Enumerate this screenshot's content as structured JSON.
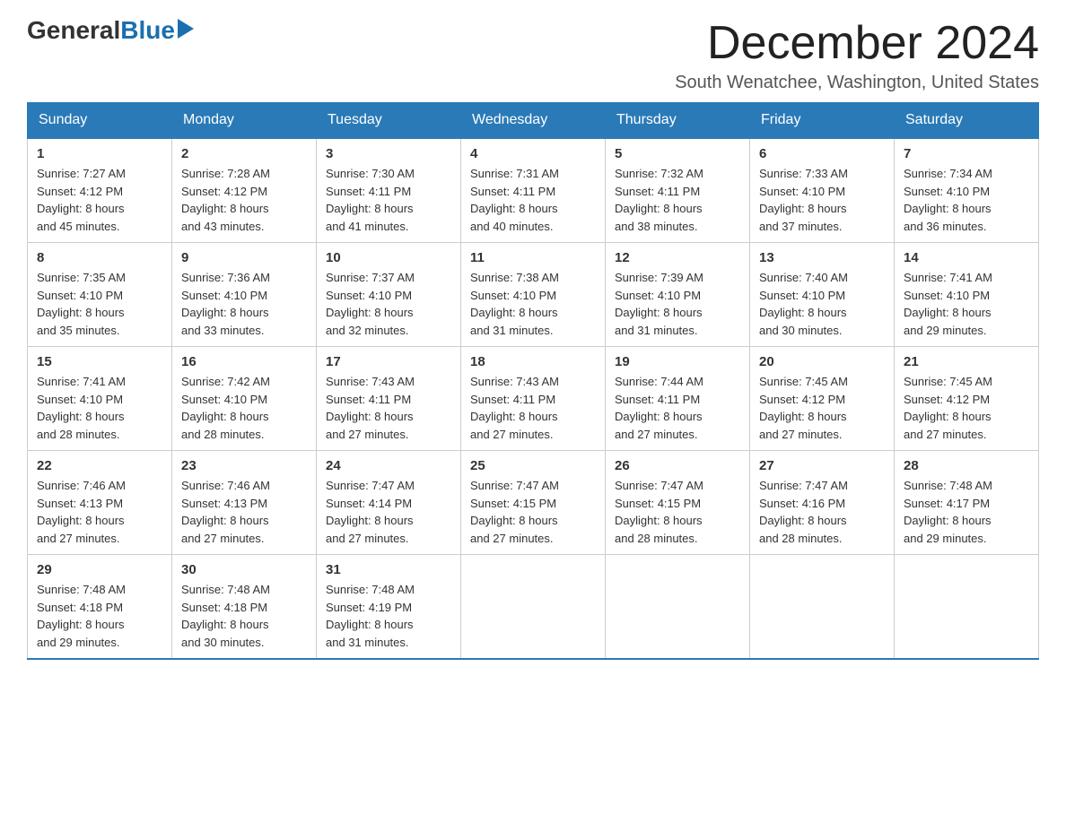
{
  "logo": {
    "general": "General",
    "blue": "Blue",
    "arrow": "▶"
  },
  "title": "December 2024",
  "location": "South Wenatchee, Washington, United States",
  "days_of_week": [
    "Sunday",
    "Monday",
    "Tuesday",
    "Wednesday",
    "Thursday",
    "Friday",
    "Saturday"
  ],
  "weeks": [
    [
      {
        "day": "1",
        "sunrise": "7:27 AM",
        "sunset": "4:12 PM",
        "daylight": "8 hours and 45 minutes."
      },
      {
        "day": "2",
        "sunrise": "7:28 AM",
        "sunset": "4:12 PM",
        "daylight": "8 hours and 43 minutes."
      },
      {
        "day": "3",
        "sunrise": "7:30 AM",
        "sunset": "4:11 PM",
        "daylight": "8 hours and 41 minutes."
      },
      {
        "day": "4",
        "sunrise": "7:31 AM",
        "sunset": "4:11 PM",
        "daylight": "8 hours and 40 minutes."
      },
      {
        "day": "5",
        "sunrise": "7:32 AM",
        "sunset": "4:11 PM",
        "daylight": "8 hours and 38 minutes."
      },
      {
        "day": "6",
        "sunrise": "7:33 AM",
        "sunset": "4:10 PM",
        "daylight": "8 hours and 37 minutes."
      },
      {
        "day": "7",
        "sunrise": "7:34 AM",
        "sunset": "4:10 PM",
        "daylight": "8 hours and 36 minutes."
      }
    ],
    [
      {
        "day": "8",
        "sunrise": "7:35 AM",
        "sunset": "4:10 PM",
        "daylight": "8 hours and 35 minutes."
      },
      {
        "day": "9",
        "sunrise": "7:36 AM",
        "sunset": "4:10 PM",
        "daylight": "8 hours and 33 minutes."
      },
      {
        "day": "10",
        "sunrise": "7:37 AM",
        "sunset": "4:10 PM",
        "daylight": "8 hours and 32 minutes."
      },
      {
        "day": "11",
        "sunrise": "7:38 AM",
        "sunset": "4:10 PM",
        "daylight": "8 hours and 31 minutes."
      },
      {
        "day": "12",
        "sunrise": "7:39 AM",
        "sunset": "4:10 PM",
        "daylight": "8 hours and 31 minutes."
      },
      {
        "day": "13",
        "sunrise": "7:40 AM",
        "sunset": "4:10 PM",
        "daylight": "8 hours and 30 minutes."
      },
      {
        "day": "14",
        "sunrise": "7:41 AM",
        "sunset": "4:10 PM",
        "daylight": "8 hours and 29 minutes."
      }
    ],
    [
      {
        "day": "15",
        "sunrise": "7:41 AM",
        "sunset": "4:10 PM",
        "daylight": "8 hours and 28 minutes."
      },
      {
        "day": "16",
        "sunrise": "7:42 AM",
        "sunset": "4:10 PM",
        "daylight": "8 hours and 28 minutes."
      },
      {
        "day": "17",
        "sunrise": "7:43 AM",
        "sunset": "4:11 PM",
        "daylight": "8 hours and 27 minutes."
      },
      {
        "day": "18",
        "sunrise": "7:43 AM",
        "sunset": "4:11 PM",
        "daylight": "8 hours and 27 minutes."
      },
      {
        "day": "19",
        "sunrise": "7:44 AM",
        "sunset": "4:11 PM",
        "daylight": "8 hours and 27 minutes."
      },
      {
        "day": "20",
        "sunrise": "7:45 AM",
        "sunset": "4:12 PM",
        "daylight": "8 hours and 27 minutes."
      },
      {
        "day": "21",
        "sunrise": "7:45 AM",
        "sunset": "4:12 PM",
        "daylight": "8 hours and 27 minutes."
      }
    ],
    [
      {
        "day": "22",
        "sunrise": "7:46 AM",
        "sunset": "4:13 PM",
        "daylight": "8 hours and 27 minutes."
      },
      {
        "day": "23",
        "sunrise": "7:46 AM",
        "sunset": "4:13 PM",
        "daylight": "8 hours and 27 minutes."
      },
      {
        "day": "24",
        "sunrise": "7:47 AM",
        "sunset": "4:14 PM",
        "daylight": "8 hours and 27 minutes."
      },
      {
        "day": "25",
        "sunrise": "7:47 AM",
        "sunset": "4:15 PM",
        "daylight": "8 hours and 27 minutes."
      },
      {
        "day": "26",
        "sunrise": "7:47 AM",
        "sunset": "4:15 PM",
        "daylight": "8 hours and 28 minutes."
      },
      {
        "day": "27",
        "sunrise": "7:47 AM",
        "sunset": "4:16 PM",
        "daylight": "8 hours and 28 minutes."
      },
      {
        "day": "28",
        "sunrise": "7:48 AM",
        "sunset": "4:17 PM",
        "daylight": "8 hours and 29 minutes."
      }
    ],
    [
      {
        "day": "29",
        "sunrise": "7:48 AM",
        "sunset": "4:18 PM",
        "daylight": "8 hours and 29 minutes."
      },
      {
        "day": "30",
        "sunrise": "7:48 AM",
        "sunset": "4:18 PM",
        "daylight": "8 hours and 30 minutes."
      },
      {
        "day": "31",
        "sunrise": "7:48 AM",
        "sunset": "4:19 PM",
        "daylight": "8 hours and 31 minutes."
      },
      null,
      null,
      null,
      null
    ]
  ]
}
